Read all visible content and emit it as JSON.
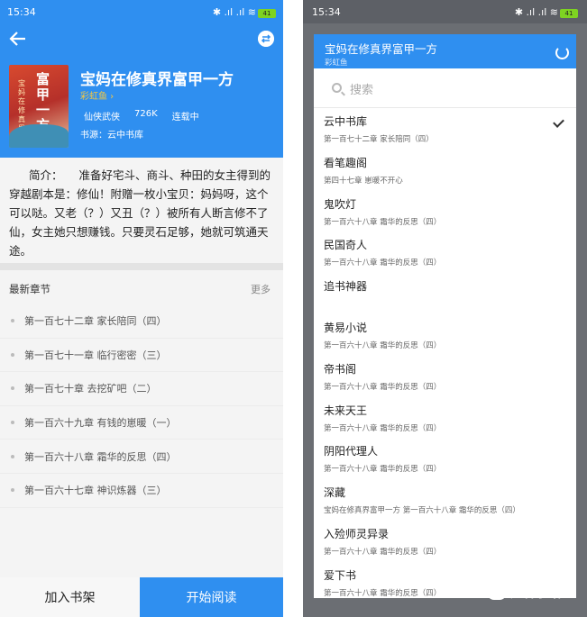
{
  "left": {
    "status_time": "15:34",
    "status_icons": "✱ .ıl .ıl ≋",
    "battery": "41",
    "book": {
      "title": "宝妈在修真界富甲一方",
      "author": "彩虹鱼 ›",
      "genre": "仙侠武侠",
      "words": "726K",
      "status": "连载中",
      "source": "书源：云中书库",
      "cover_title": "富甲一方",
      "cover_sub": "宝妈在修真界"
    },
    "intro_label": "简介：",
    "intro": "准备好宅斗、商斗、种田的女主得到的穿越剧本是：修仙！附赠一枚小宝贝：妈妈呀，这个可以哒。又老（？）又丑（？）被所有人断言修不了仙，女主她只想赚钱。只要灵石足够，她就可筑通天途。",
    "latest_label": "最新章节",
    "more_label": "更多",
    "chapters": [
      "第一百七十二章 家长陪同（四）",
      "第一百七十一章 临行密密（三）",
      "第一百七十章 去挖矿吧（二）",
      "第一百六十九章 有钱的崽暖（一）",
      "第一百六十八章 霜华的反思（四）",
      "第一百六十七章 神识炼器（三）"
    ],
    "add_shelf": "加入书架",
    "start_read": "开始阅读"
  },
  "right": {
    "status_time": "15:34",
    "battery": "41",
    "dialog_title": "宝妈在修真界富甲一方",
    "dialog_sub": "彩虹鱼",
    "search_placeholder": "搜索",
    "sources": [
      {
        "name": "云中书库",
        "chapter": "第一百七十二章 家长陪同（四）",
        "selected": true
      },
      {
        "name": "看笔趣阁",
        "chapter": "第四十七章 崽暖不开心"
      },
      {
        "name": "鬼吹灯",
        "chapter": "第一百六十八章 霜华的反思（四）"
      },
      {
        "name": "民国奇人",
        "chapter": "第一百六十八章 霜华的反思（四）"
      },
      {
        "name": "追书神器",
        "chapter": ""
      },
      {
        "name": "黄易小说",
        "chapter": "第一百六十八章 霜华的反思（四）"
      },
      {
        "name": "帝书阁",
        "chapter": "第一百六十八章 霜华的反思（四）"
      },
      {
        "name": "未来天王",
        "chapter": "第一百六十八章 霜华的反思（四）"
      },
      {
        "name": "阴阳代理人",
        "chapter": "第一百六十八章 霜华的反思（四）"
      },
      {
        "name": "深藏",
        "chapter": "宝妈在修真界富甲一方 第一百六十八章 霜华的反思（四）"
      },
      {
        "name": "入殓师灵异录",
        "chapter": "第一百六十八章 霜华的反思（四）"
      },
      {
        "name": "爱下书",
        "chapter": "第一百六十八章 霜华的反思（四）"
      }
    ],
    "watermark": "知客小站"
  }
}
